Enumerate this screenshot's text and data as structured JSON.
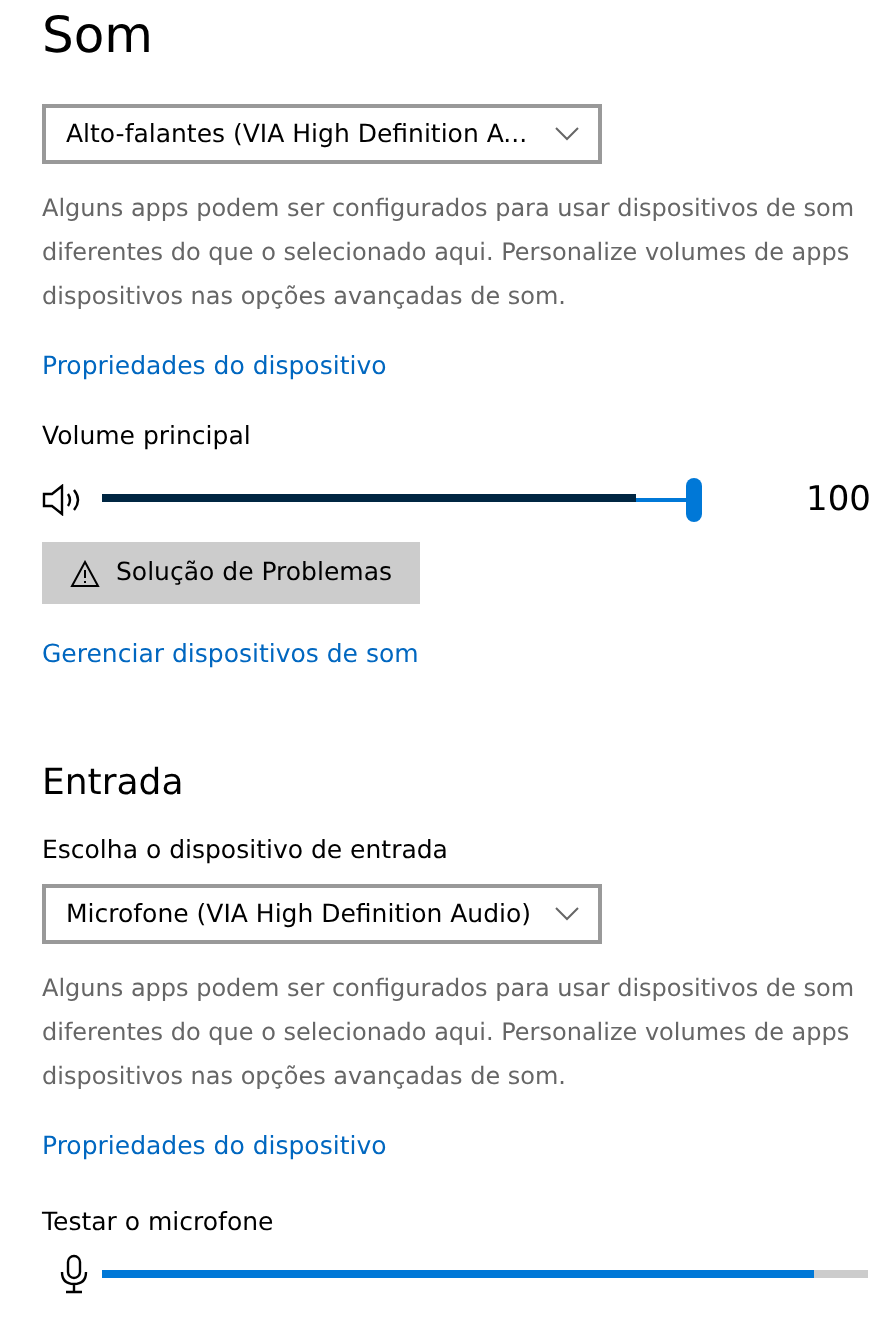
{
  "title": "Som",
  "output": {
    "device": {
      "value": "Alto-falantes (VIA High Definition A..."
    },
    "description": [
      "Alguns apps podem ser configurados para usar dispositivos de som",
      "diferentes do que o selecionado aqui. Personalize volumes de apps",
      "dispositivos nas opções avançadas de som."
    ],
    "properties_link": "Propriedades do dispositivo",
    "volume": {
      "label": "Volume principal",
      "level": 1.0,
      "meter": {
        "level": 0.89
      },
      "reading": "100"
    },
    "troubleshoot_button": "Solução de Problemas",
    "manage_link": "Gerenciar dispositivos de som"
  },
  "input": {
    "heading": "Entrada",
    "device_label": "Escolha o dispositivo de entrada",
    "device": {
      "value": "Microfone (VIA High Definition Audio)"
    },
    "description": [
      "Alguns apps podem ser configurados para usar dispositivos de som",
      "diferentes do que o selecionado aqui. Personalize volumes de apps",
      "dispositivos nas opções avançadas de som."
    ],
    "properties_link": "Propriedades do dispositivo",
    "test": {
      "label": "Testar o microfone",
      "level": 0.93
    }
  }
}
